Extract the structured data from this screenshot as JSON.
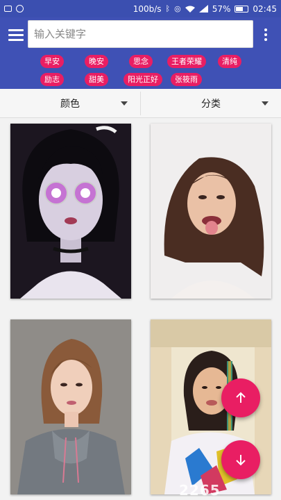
{
  "status_bar": {
    "speed": "100b/s",
    "battery": "57%",
    "time": "02:45"
  },
  "search": {
    "placeholder": "输入关键字"
  },
  "tags": [
    "早安",
    "晚安",
    "思念",
    "王者荣耀",
    "清纯",
    "励志",
    "甜美",
    "阳光正好",
    "张筱雨"
  ],
  "filters": {
    "color_label": "颜色",
    "category_label": "分类"
  },
  "photos": [
    {
      "subject": "anime-girl-pink-glasses"
    },
    {
      "subject": "woman-tongue-out"
    },
    {
      "subject": "woman-grey-hoodie"
    },
    {
      "subject": "girl-colorful-shirt"
    }
  ],
  "colors": {
    "app_bar": "#3f51b5",
    "status_bar": "#3b4fb0",
    "accent": "#e91e63"
  },
  "icons": {
    "menu": "hamburger-icon",
    "more": "vertical-dots-icon",
    "up": "arrow-up-icon",
    "down": "arrow-down-icon"
  }
}
